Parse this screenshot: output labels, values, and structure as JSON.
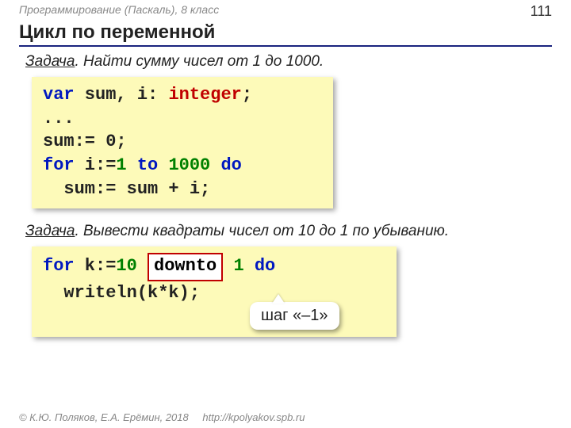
{
  "header": {
    "course": "Программирование (Паскаль), 8 класс",
    "page_number": "111"
  },
  "title": "Цикл по переменной",
  "task1": {
    "lead": "Задача",
    "text": ". Найти сумму чисел от 1 до 1000."
  },
  "code1": {
    "l1_kw_var": "var",
    "l1_ids": " sum, i: ",
    "l1_kw_int": "integer",
    "l1_semi": ";",
    "l2": "...",
    "l3": "sum:= 0;",
    "l4_kw_for": "for",
    "l4_mid1": " i:=",
    "l4_n1": "1",
    "l4_kw_to": " to ",
    "l4_n2": "1000",
    "l4_kw_do": " do",
    "l5": "  sum:= sum + i;"
  },
  "task2": {
    "lead": "Задача",
    "text": ". Вывести квадраты чисел от 10 до 1 по убыванию."
  },
  "code2": {
    "l1_kw_for": "for",
    "l1_mid1": " k:=",
    "l1_n1": "10",
    "l1_sp1": " ",
    "l1_downto": "downto",
    "l1_sp2": " ",
    "l1_n2": "1",
    "l1_kw_do": " do",
    "l2": "  writeln(k*k);"
  },
  "callout": "шаг «–1»",
  "footer": {
    "copyright": "© К.Ю. Поляков, Е.А. Ерёмин, 2018",
    "url": "http://kpolyakov.spb.ru"
  }
}
